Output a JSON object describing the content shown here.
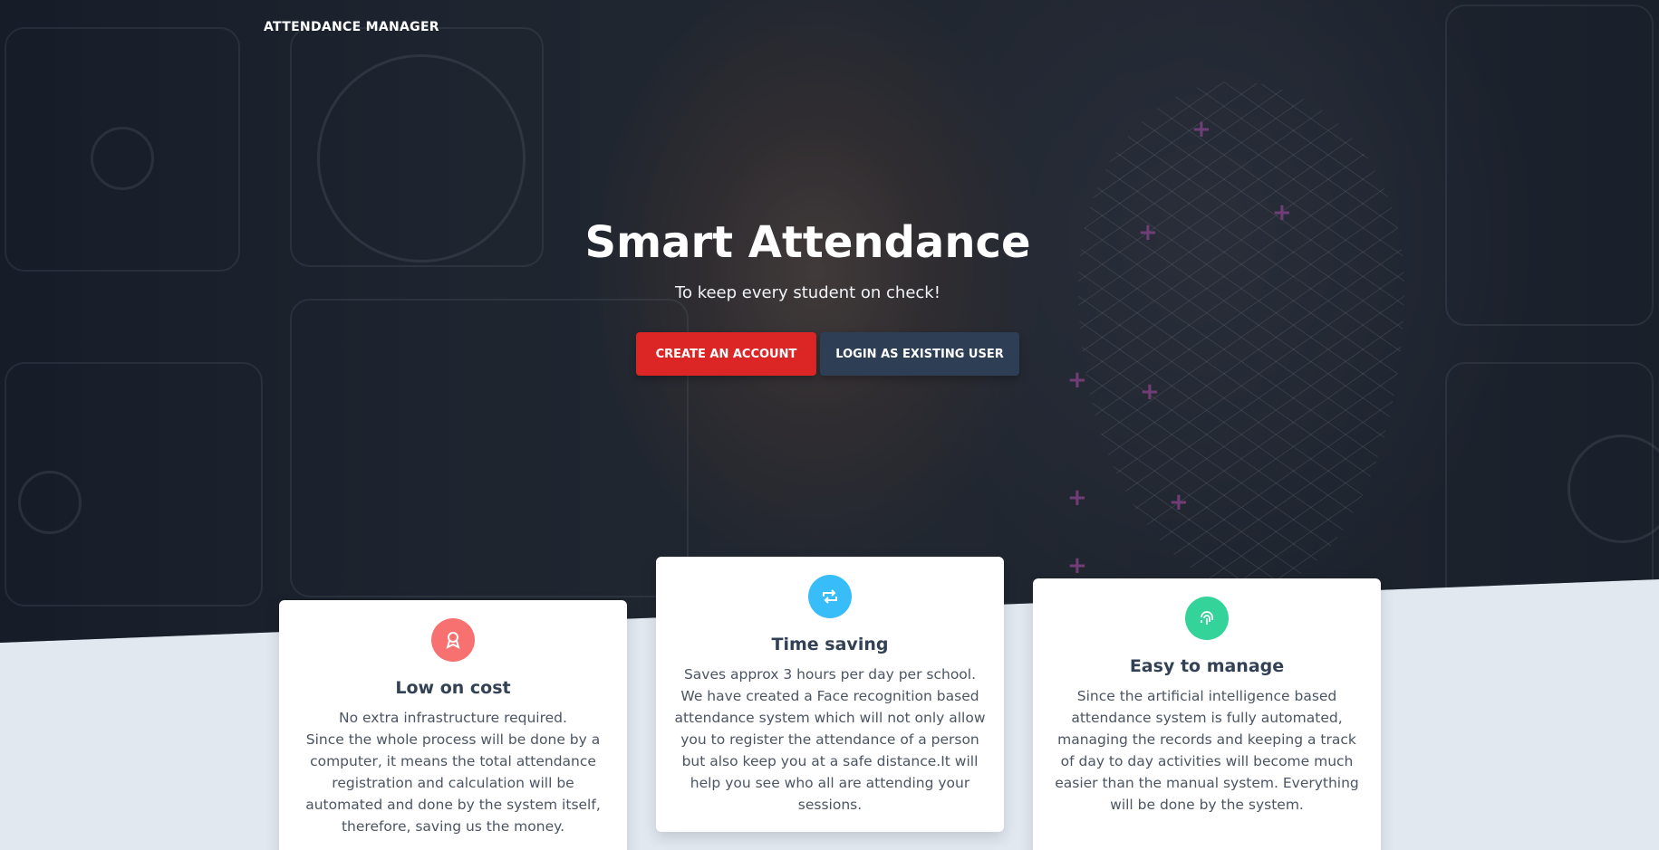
{
  "header": {
    "brand": "ATTENDANCE MANAGER"
  },
  "hero": {
    "title": "Smart Attendance",
    "subtitle": "To keep every student on check!",
    "primary_button": "CREATE AN ACCOUNT",
    "secondary_button": "LOGIN AS EXISTING USER"
  },
  "features": [
    {
      "icon": "award-icon",
      "color": "#f87171",
      "title": "Low on cost",
      "text": "No extra infrastructure required.\nSince the whole process will be done by a computer, it means the total attendance registration and calculation will be automated and done by the system itself, therefore, saving us the money."
    },
    {
      "icon": "retweet-icon",
      "color": "#38bdf8",
      "title": "Time saving",
      "text": "Saves approx 3 hours per day per school.\nWe have created a Face recognition based attendance system which will not only allow you to register the attendance of a person but also keep you at a safe distance.It will help you see who all are attending your sessions."
    },
    {
      "icon": "fingerprint-icon",
      "color": "#34d399",
      "title": "Easy to manage",
      "text": "Since the artificial intelligence based attendance system is fully automated, managing the records and keeping a track of day to day activities will become much easier than the manual system. Everything will be done by the system."
    }
  ]
}
